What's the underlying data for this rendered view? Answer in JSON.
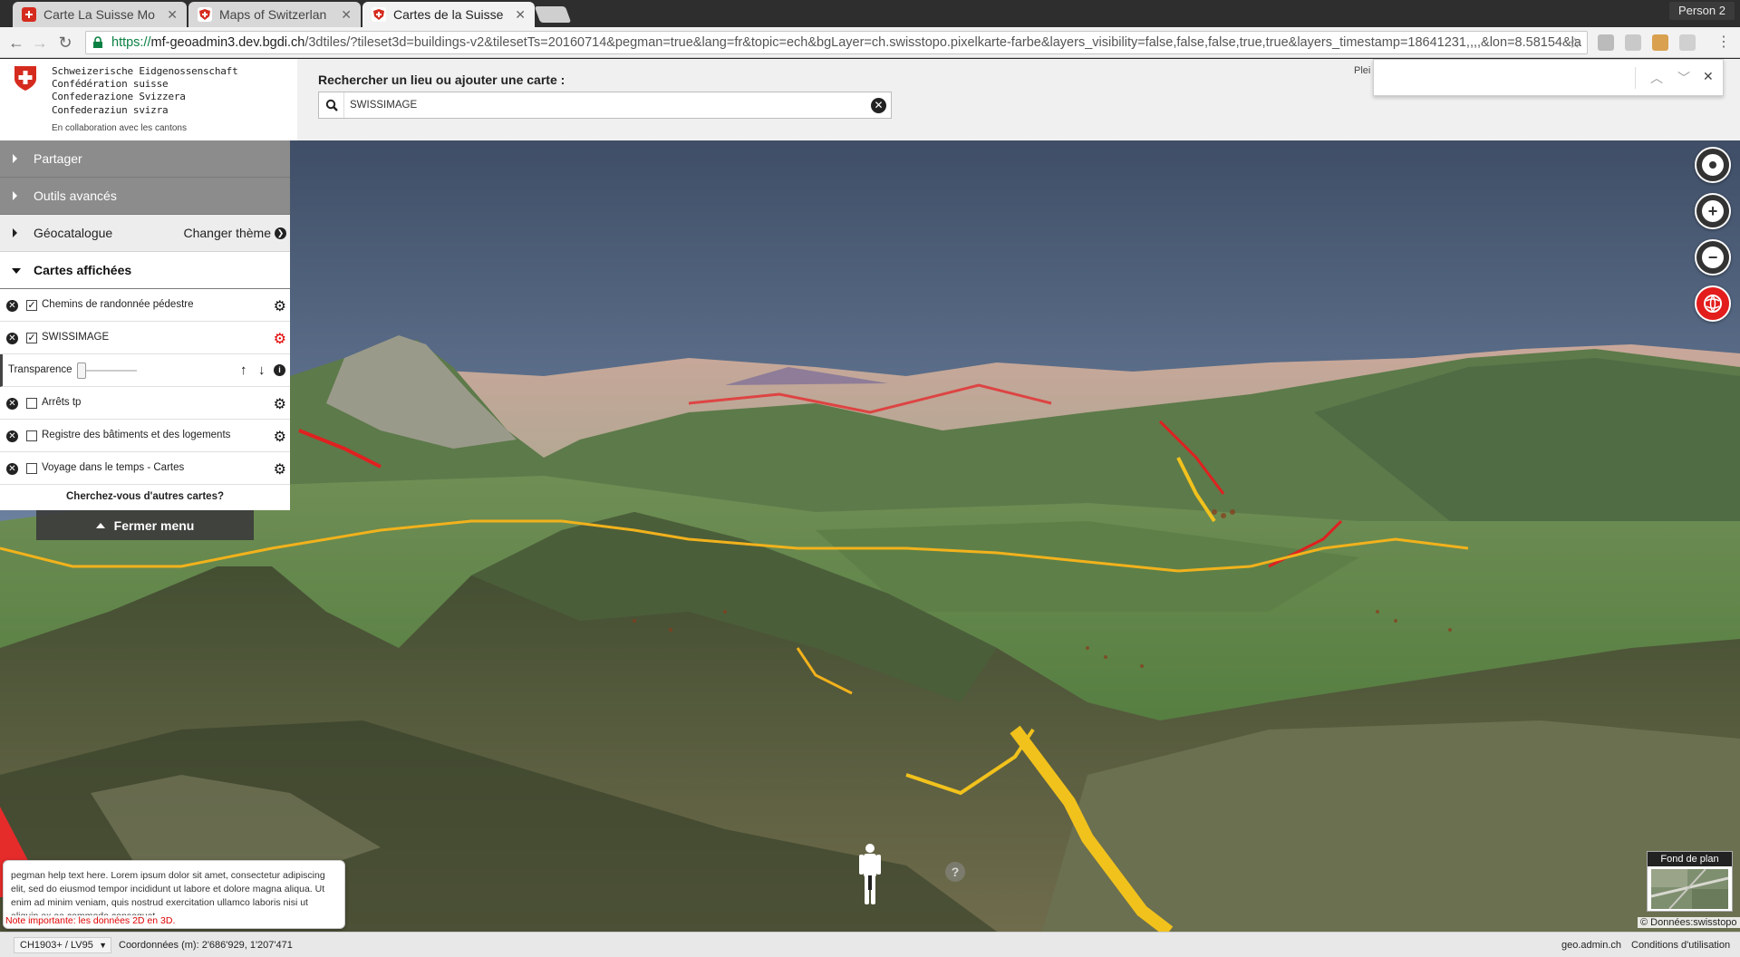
{
  "browser": {
    "tabs": [
      {
        "title": "Carte La Suisse Mo",
        "active": false
      },
      {
        "title": "Maps of Switzerlan",
        "active": false
      },
      {
        "title": "Cartes de la Suisse",
        "active": true
      }
    ],
    "profile": "Person 2",
    "url_scheme": "https://",
    "url_host": "mf-geoadmin3.dev.bgdi.ch",
    "url_rest": "/3dtiles/?tileset3d=buildings-v2&tilesetTs=20160714&pegman=true&lang=fr&topic=ech&bgLayer=ch.swisstopo.pixelkarte-farbe&layers_visibility=false,false,false,true,true&layers_timestamp=18641231,,,,&lon=8.58154&la"
  },
  "header": {
    "brand_lines": [
      "Schweizerische Eidgenossenschaft",
      "Confédération suisse",
      "Confederazione Svizzera",
      "Confederaziun svizra"
    ],
    "collab": "En collaboration avec les cantons",
    "search_label": "Rechercher un lieu ou ajouter une carte :",
    "search_value": "SWISSIMAGE",
    "plein": "Plei"
  },
  "menu": {
    "share": "Partager",
    "tools": "Outils avancés",
    "catalog": "Géocatalogue",
    "change_theme": "Changer thème",
    "displayed": "Cartes affichées",
    "layers": [
      {
        "name": "Chemins de randonnée pédestre",
        "checked": true
      },
      {
        "name": "SWISSIMAGE",
        "checked": true
      },
      {
        "name": "Arrêts tp",
        "checked": false
      },
      {
        "name": "Registre des bâtiments et des logements",
        "checked": false
      },
      {
        "name": "Voyage dans le temps - Cartes",
        "checked": false
      }
    ],
    "transparency": "Transparence",
    "more_maps": "Cherchez-vous d'autres cartes?",
    "close_menu": "Fermer menu"
  },
  "help": {
    "text": "pegman help text here. Lorem ipsum dolor sit amet, consectetur adipiscing elit, sed do eiusmod tempor incididunt ut labore et dolore magna aliqua. Ut enim ad minim veniam, quis nostrud exercitation ullamco laboris nisi ut aliquip ex ea commodo consequat.",
    "note": "Note importante: les données 2D en 3D."
  },
  "map": {
    "background_label": "Fond de plan",
    "attribution": "© Données:swisstopo"
  },
  "footer": {
    "projection": "CH1903+ / LV95",
    "coordinates": "Coordonnées (m): 2'686'929, 1'207'471",
    "link_geo": "geo.admin.ch",
    "link_terms": "Conditions d'utilisation"
  }
}
